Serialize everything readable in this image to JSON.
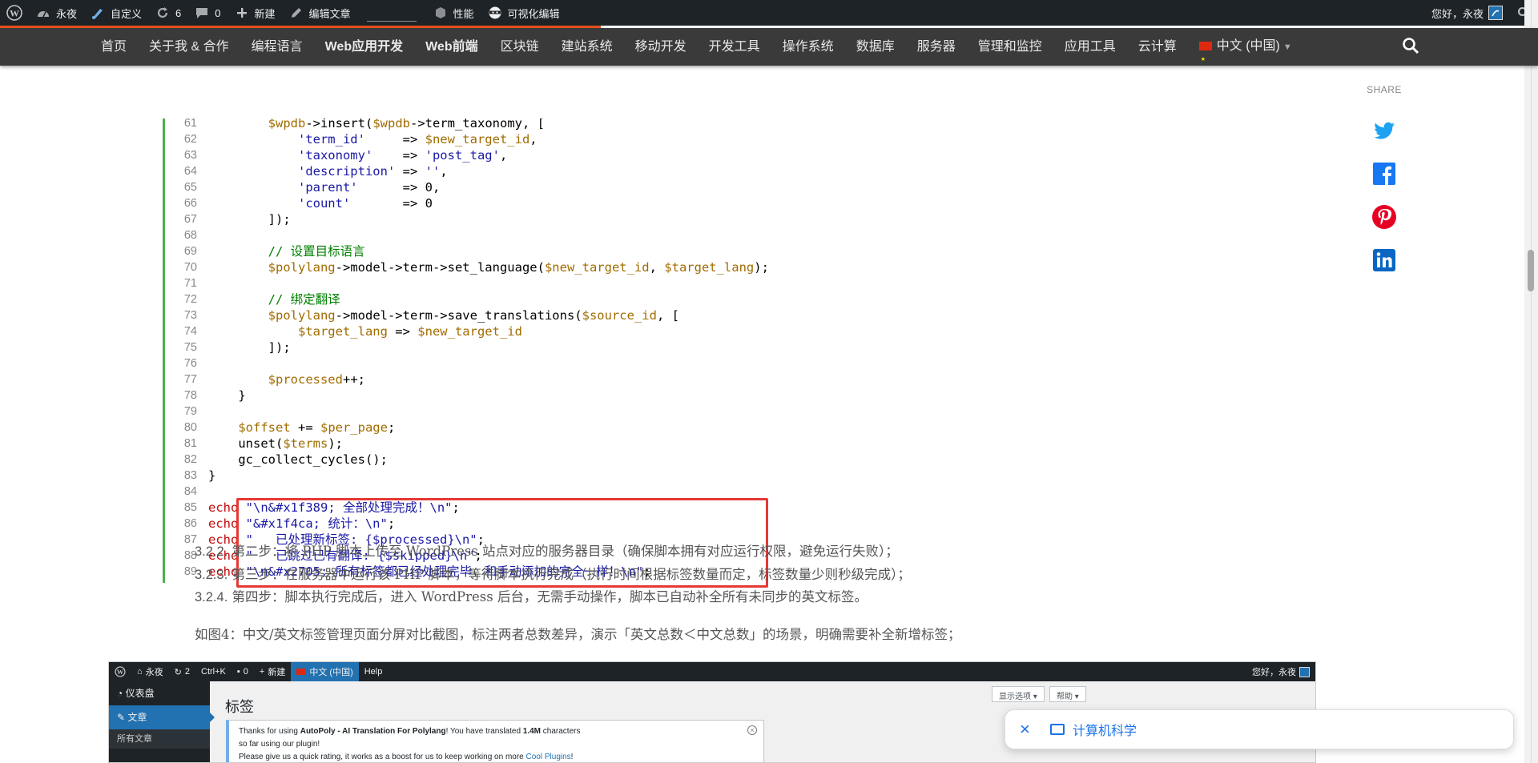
{
  "adminbar": {
    "site_name": "永夜",
    "customize": "自定义",
    "updates_count": "6",
    "comments_count": "0",
    "new": "新建",
    "edit_post": "编辑文章",
    "performance": "性能",
    "visual_editor": "可视化编辑",
    "greeting": "您好，永夜"
  },
  "nav": {
    "items": [
      "首页",
      "关于我 & 合作",
      "编程语言",
      "Web应用开发",
      "Web前端",
      "区块链",
      "建站系统",
      "移动开发",
      "开发工具",
      "操作系统",
      "数据库",
      "服务器",
      "管理和监控",
      "应用工具",
      "云计算"
    ],
    "language": "中文 (中国)"
  },
  "code": {
    "lines": [
      {
        "n": "61",
        "html": "        <span class=\"c-var\">$wpdb</span>->insert(<span class=\"c-var\">$wpdb</span>->term_taxonomy, ["
      },
      {
        "n": "62",
        "html": "            <span class=\"c-str\">'term_id'</span>     => <span class=\"c-var\">$new_target_id</span>,"
      },
      {
        "n": "63",
        "html": "            <span class=\"c-str\">'taxonomy'</span>    => <span class=\"c-str\">'post_tag'</span>,"
      },
      {
        "n": "64",
        "html": "            <span class=\"c-str\">'description'</span> => <span class=\"c-str\">''</span>,"
      },
      {
        "n": "65",
        "html": "            <span class=\"c-str\">'parent'</span>      => 0,"
      },
      {
        "n": "66",
        "html": "            <span class=\"c-str\">'count'</span>       => 0"
      },
      {
        "n": "67",
        "html": "        ]);"
      },
      {
        "n": "68",
        "html": ""
      },
      {
        "n": "69",
        "html": "        <span class=\"c-cmt\">// 设置目标语言</span>"
      },
      {
        "n": "70",
        "html": "        <span class=\"c-var\">$polylang</span>->model->term->set_language(<span class=\"c-var\">$new_target_id</span>, <span class=\"c-var\">$target_lang</span>);"
      },
      {
        "n": "71",
        "html": ""
      },
      {
        "n": "72",
        "html": "        <span class=\"c-cmt\">// 绑定翻译</span>"
      },
      {
        "n": "73",
        "html": "        <span class=\"c-var\">$polylang</span>->model->term->save_translations(<span class=\"c-var\">$source_id</span>, ["
      },
      {
        "n": "74",
        "html": "            <span class=\"c-var\">$target_lang</span> => <span class=\"c-var\">$new_target_id</span>"
      },
      {
        "n": "75",
        "html": "        ]);"
      },
      {
        "n": "76",
        "html": ""
      },
      {
        "n": "77",
        "html": "        <span class=\"c-var\">$processed</span>++;"
      },
      {
        "n": "78",
        "html": "    }"
      },
      {
        "n": "79",
        "html": ""
      },
      {
        "n": "80",
        "html": "    <span class=\"c-var\">$offset</span> += <span class=\"c-var\">$per_page</span>;"
      },
      {
        "n": "81",
        "html": "    unset(<span class=\"c-var\">$terms</span>);"
      },
      {
        "n": "82",
        "html": "    gc_collect_cycles();"
      },
      {
        "n": "83",
        "html": "}"
      },
      {
        "n": "84",
        "html": ""
      },
      {
        "n": "85",
        "html": "<span class=\"c-kw\">echo</span> <span class=\"c-str\">\"\\n&amp;#x1f389; 全部处理完成！\\n\"</span>;"
      },
      {
        "n": "86",
        "html": "<span class=\"c-kw\">echo</span> <span class=\"c-str\">\"&amp;#x1f4ca; 统计：\\n\"</span>;"
      },
      {
        "n": "87",
        "html": "<span class=\"c-kw\">echo</span> <span class=\"c-str\">\"   已处理新标签: {$processed}\\n\"</span>;"
      },
      {
        "n": "88",
        "html": "<span class=\"c-kw\">echo</span> <span class=\"c-str\">\"   已跳过已有翻译: {$skipped}\\n\"</span>;"
      },
      {
        "n": "89",
        "html": "<span class=\"c-kw\">echo</span> <span class=\"c-str\">\"\\n&amp;#x2705; 所有标签都已经处理完毕，和手动添加的完全一样！\\n\"</span>;"
      }
    ]
  },
  "steps": [
    {
      "num": "3.2.2.",
      "text": "第二步：将 PHP 脚本上传至 WordPress 站点对应的服务器目录（确保脚本拥有对应运行权限，避免运行失败）；"
    },
    {
      "num": "3.2.3.",
      "text": "第三步：在服务器中运行该 PHP 脚本，等待脚本执行完成（执行时间根据标签数量而定，标签数量少则秒级完成）；"
    },
    {
      "num": "3.2.4.",
      "text": "第四步：脚本执行完成后，进入 WordPress 后台，无需手动操作，脚本已自动补全所有未同步的英文标签。"
    }
  ],
  "figure_caption": "如图4：中文/英文标签管理页面分屏对比截图，标注两者总数差异，演示「英文总数＜中文总数」的场景，明确需要补全新增标签；",
  "screenshot": {
    "site_name": "永夜",
    "updates": "2",
    "shortcut": "Ctrl+K",
    "comments": "0",
    "new": "新建",
    "language": "中文 (中国)",
    "help_menu": "Help",
    "greeting": "您好，永夜",
    "dashboard": "仪表盘",
    "posts": "文章",
    "all_posts": "所有文章",
    "page_title": "标签",
    "screen_options": "显示选项 ▾",
    "help": "帮助 ▾",
    "notice_line1_pre": "Thanks for using ",
    "notice_plugin": "AutoPoly - AI Translation For Polylang",
    "notice_line1_mid": "! You have translated ",
    "notice_amount": "1.4M",
    "notice_line1_post": " characters",
    "notice_line2": "so far using our plugin!",
    "notice_line3": "Please give us a quick rating, it works as a boost for us to keep working on more ",
    "notice_link": "Cool Plugins",
    "notice_line3_end": "!"
  },
  "share": {
    "label": "SHARE"
  },
  "toast": {
    "text": "计算机科学"
  },
  "colors": {
    "accent_orange": "#e8511e",
    "highlight_red": "#e53935",
    "code_border_green": "#4caf50",
    "link_blue": "#1a73e8"
  }
}
